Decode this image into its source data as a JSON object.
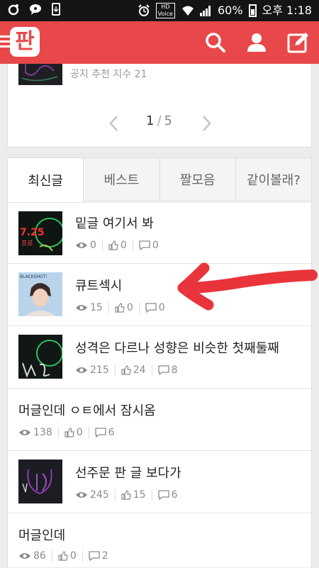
{
  "status_bar": {
    "hd_label": "HD",
    "voice_label": "Voice",
    "battery": "60%",
    "time": "오후 1:18"
  },
  "app": {
    "logo": "판"
  },
  "notice": {
    "text": "공지 추천 지수 21"
  },
  "pagination": {
    "current": "1",
    "separator": "/",
    "total": "5"
  },
  "tabs": [
    "최신글",
    "베스트",
    "짤모음",
    "같이볼래?"
  ],
  "posts": [
    {
      "title": "밑글 여기서 봐",
      "views": "0",
      "likes": "0",
      "comments": "0"
    },
    {
      "title": "큐트섹시",
      "views": "15",
      "likes": "0",
      "comments": "0"
    },
    {
      "title": "성격은 다르나 성향은 비슷한 첫째둘째",
      "views": "215",
      "likes": "24",
      "comments": "8"
    },
    {
      "title": "머글인데 ㅇㅌ에서 잠시옴",
      "views": "138",
      "likes": "0",
      "comments": "6"
    },
    {
      "title": "선주문 판 글 보다가",
      "views": "245",
      "likes": "15",
      "comments": "6"
    },
    {
      "title": "머글인데",
      "views": "86",
      "likes": "0",
      "comments": "2"
    }
  ],
  "thumb_text": {
    "t1": "7.25",
    "t1b": "프로",
    "t2": "BLACKSHOT!"
  },
  "colors": {
    "brand": "#e8484a",
    "annotation": "#e8343a"
  }
}
